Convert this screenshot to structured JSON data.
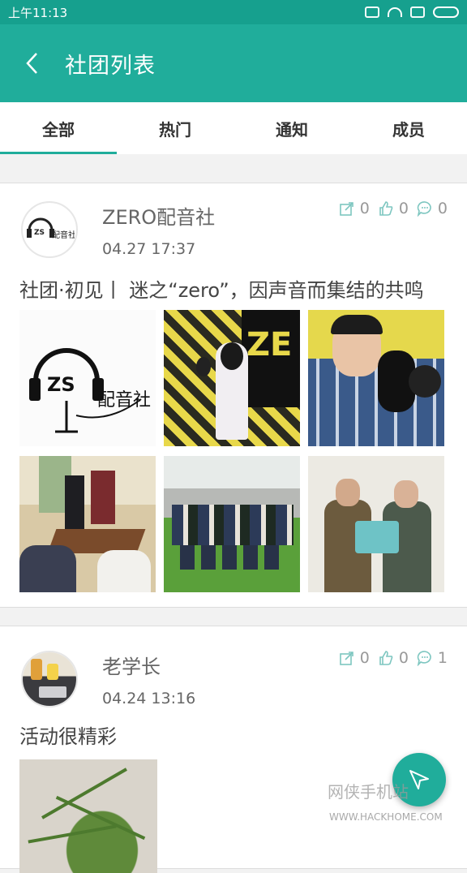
{
  "statusbar": {
    "time": "上午11:13"
  },
  "appbar": {
    "title": "社团列表",
    "back_icon": "chevron-left-icon"
  },
  "tabs": [
    {
      "label": "全部",
      "active": true
    },
    {
      "label": "热门",
      "active": false
    },
    {
      "label": "通知",
      "active": false
    },
    {
      "label": "成员",
      "active": false
    }
  ],
  "posts": [
    {
      "name": "ZERO配音社",
      "time": "04.27 17:37",
      "shares": "0",
      "likes": "0",
      "comments": "0",
      "text": "社团·初见丨 迷之“zero”，因声音而集结的共鸣",
      "avatar_text": "配音社",
      "logo_text": "配音社"
    },
    {
      "name": "老学长",
      "time": "04.24 13:16",
      "shares": "0",
      "likes": "0",
      "comments": "1",
      "text": "活动很精彩"
    }
  ],
  "watermark": {
    "text": "网侠手机站",
    "url": "WWW.HACKHOME.COM"
  },
  "colors": {
    "primary": "#20ad9b",
    "statusbar": "#16a08e",
    "icon": "#7dc6c0"
  }
}
